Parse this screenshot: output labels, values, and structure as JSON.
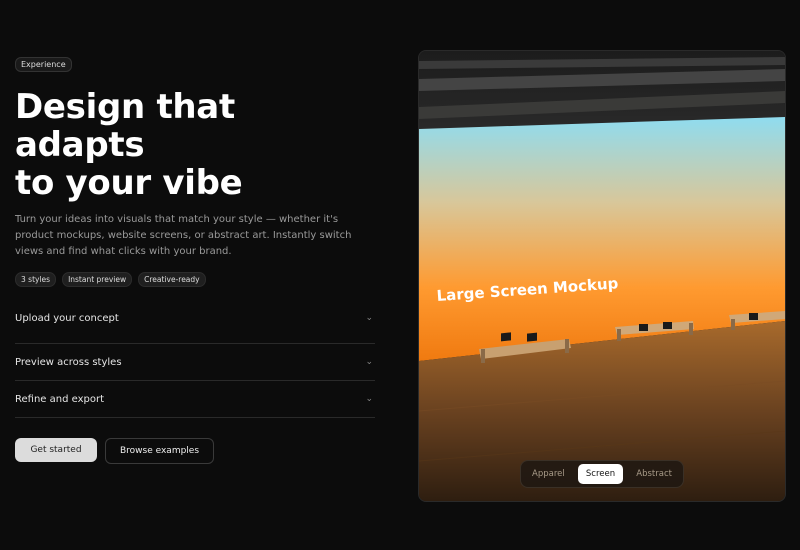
{
  "hero": {
    "badge": "Experience",
    "title": "Design that adapts\nto your vibe",
    "description": "Turn your ideas into visuals that match your style — whether it's product mockups, website screens, or abstract art. Instantly switch views and find what clicks with your brand.",
    "tags": [
      "3 styles",
      "Instant preview",
      "Creative-ready"
    ]
  },
  "accordion": {
    "items": [
      {
        "label": "Upload your concept"
      },
      {
        "label": "Preview across styles"
      },
      {
        "label": "Refine and export"
      }
    ]
  },
  "actions": {
    "primary_label": "Get started",
    "secondary_label": "Browse examples"
  },
  "preview": {
    "screen_text": "Large Screen Mockup",
    "tabs": [
      {
        "label": "Apparel",
        "active": false
      },
      {
        "label": "Screen",
        "active": true
      },
      {
        "label": "Abstract",
        "active": false
      }
    ]
  },
  "icons": {
    "chevron": "chevron-down-icon"
  },
  "colors": {
    "background": "#0c0c0c",
    "screen_top": "#8fdcf0",
    "screen_bottom": "#ff8a1a"
  }
}
